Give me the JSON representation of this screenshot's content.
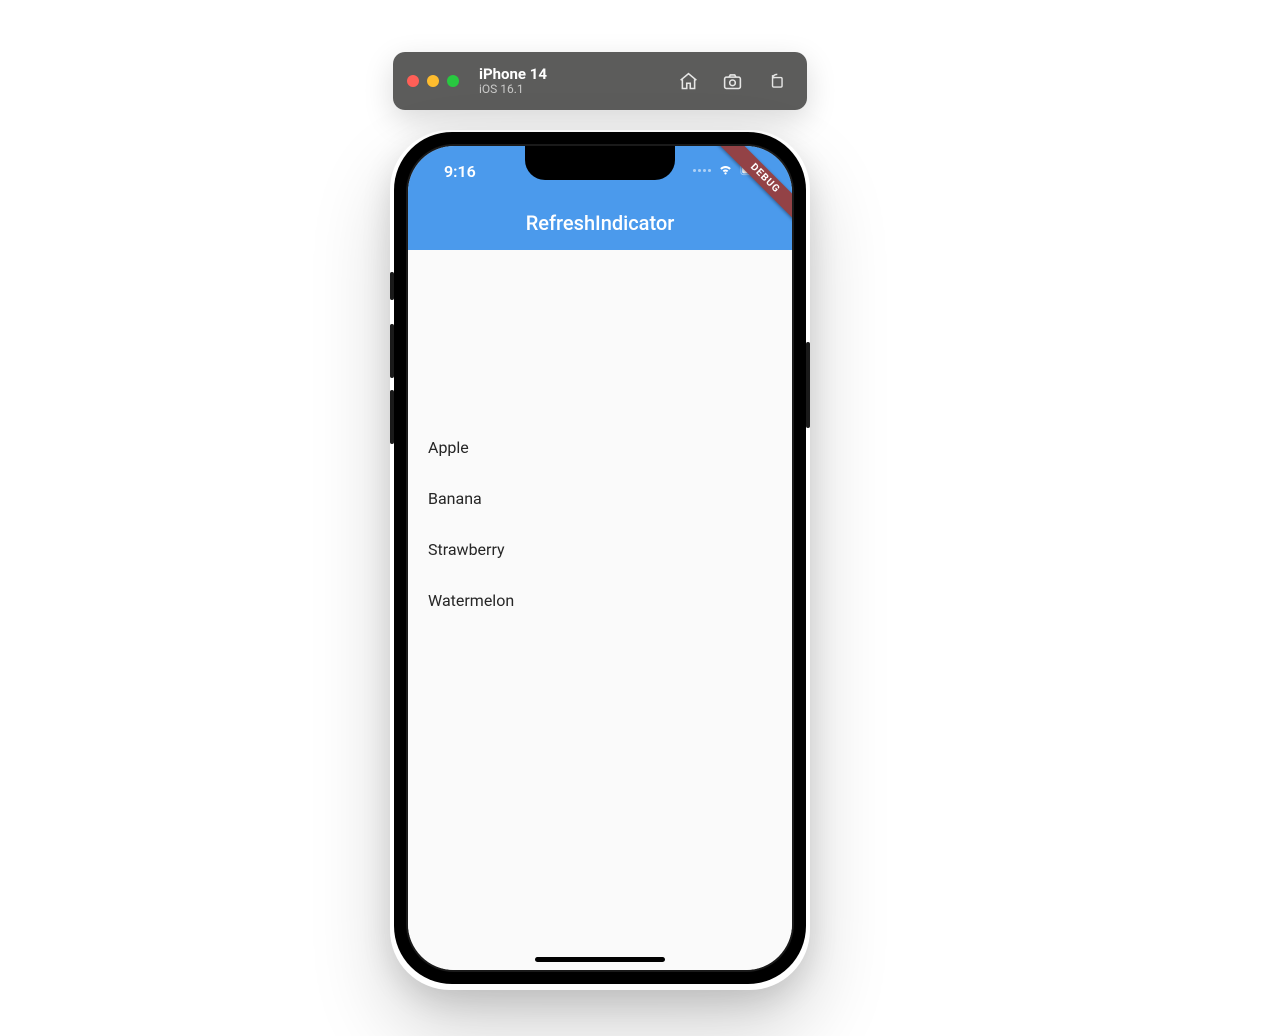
{
  "simulator": {
    "device": "iPhone 14",
    "os": "iOS 16.1"
  },
  "status": {
    "time": "9:16"
  },
  "app": {
    "title": "RefreshIndicator",
    "debug_label": "DEBUG"
  },
  "list": {
    "items": [
      {
        "label": "Apple"
      },
      {
        "label": "Banana"
      },
      {
        "label": "Strawberry"
      },
      {
        "label": "Watermelon"
      }
    ]
  }
}
